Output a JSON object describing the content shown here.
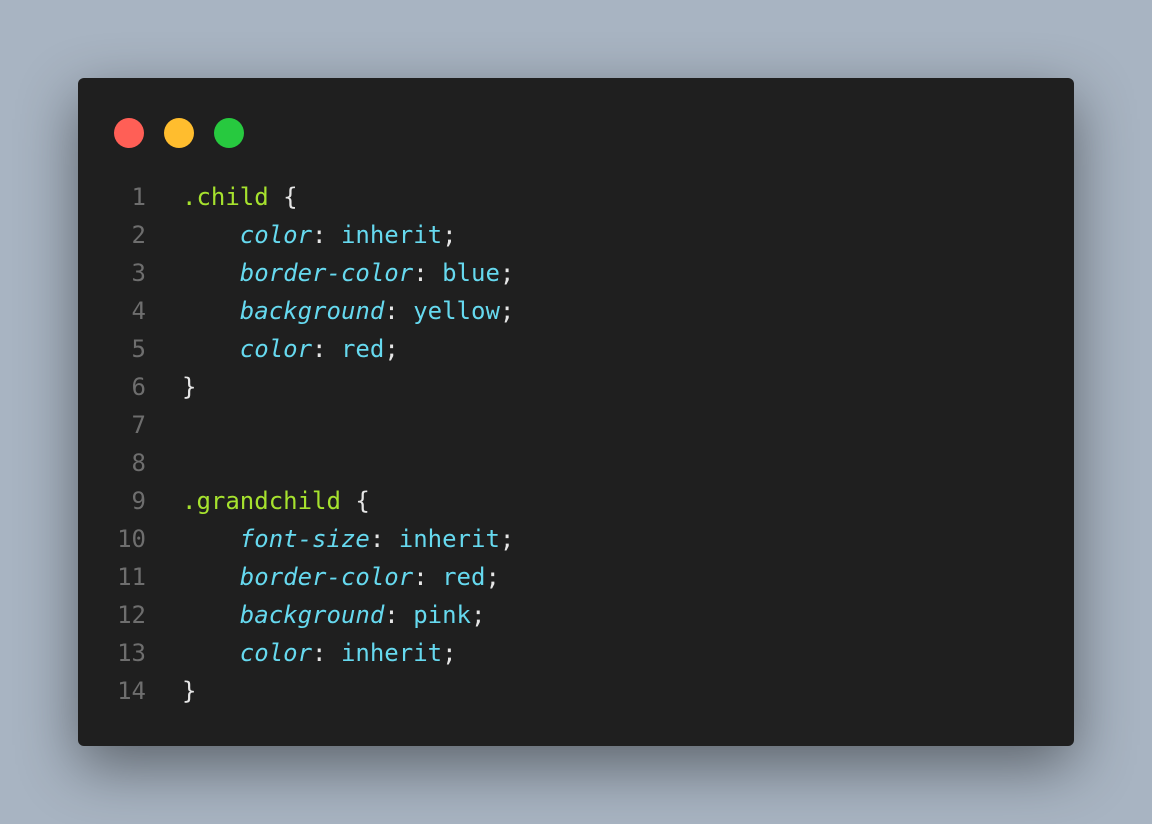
{
  "window": {
    "controls": [
      {
        "name": "close",
        "color": "#ff5f56"
      },
      {
        "name": "minimize",
        "color": "#ffbd2e"
      },
      {
        "name": "maximize",
        "color": "#27c93f"
      }
    ]
  },
  "code": {
    "lines": [
      {
        "n": "1",
        "type": "selector",
        "selector": ".child",
        "brace": " {"
      },
      {
        "n": "2",
        "type": "decl",
        "prop": "color",
        "value": "inherit"
      },
      {
        "n": "3",
        "type": "decl",
        "prop": "border-color",
        "value": "blue"
      },
      {
        "n": "4",
        "type": "decl",
        "prop": "background",
        "value": "yellow"
      },
      {
        "n": "5",
        "type": "decl",
        "prop": "color",
        "value": "red"
      },
      {
        "n": "6",
        "type": "close",
        "brace": "}"
      },
      {
        "n": "7",
        "type": "blank"
      },
      {
        "n": "8",
        "type": "blank"
      },
      {
        "n": "9",
        "type": "selector",
        "selector": ".grandchild",
        "brace": " {"
      },
      {
        "n": "10",
        "type": "decl",
        "prop": "font-size",
        "value": "inherit"
      },
      {
        "n": "11",
        "type": "decl",
        "prop": "border-color",
        "value": "red"
      },
      {
        "n": "12",
        "type": "decl",
        "prop": "background",
        "value": "pink"
      },
      {
        "n": "13",
        "type": "decl",
        "prop": "color",
        "value": "inherit"
      },
      {
        "n": "14",
        "type": "close",
        "brace": "}"
      }
    ]
  }
}
